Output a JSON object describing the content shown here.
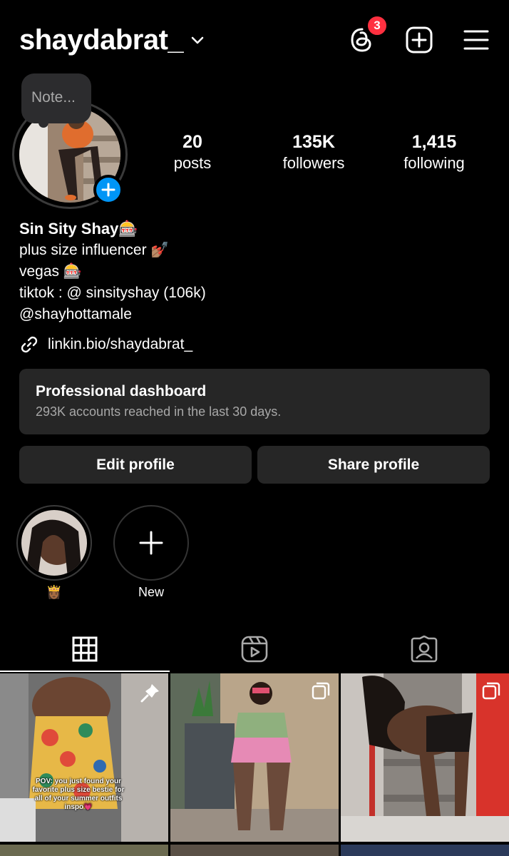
{
  "header": {
    "username": "shaydabrat_",
    "threads_badge_count": "3",
    "icons": [
      "chevron-down-icon",
      "threads-icon",
      "create-post-icon",
      "menu-icon"
    ]
  },
  "note": {
    "placeholder": "Note..."
  },
  "stats": [
    {
      "value": "20",
      "label": "posts"
    },
    {
      "value": "135K",
      "label": "followers"
    },
    {
      "value": "1,415",
      "label": "following"
    }
  ],
  "bio": {
    "name": "Sin Sity Shay🎰",
    "lines": [
      "plus size influencer 💅🏽",
      "vegas 🎰",
      "tiktok : @ sinsityshay (106k)",
      "@shayhottamale"
    ],
    "link": "linkin.bio/shaydabrat_"
  },
  "dashboard": {
    "title": "Professional dashboard",
    "subtitle": "293K accounts reached in the last 30 days."
  },
  "buttons": {
    "edit": "Edit profile",
    "share": "Share profile"
  },
  "highlights": [
    {
      "label": "👸🏾"
    },
    {
      "label": "New"
    }
  ],
  "tabs": [
    "grid-icon",
    "reels-icon",
    "tagged-icon"
  ],
  "posts": [
    {
      "caption": "POV: you just found your favorite plus size bestie for all of your summer outfits inspo💗",
      "pinned": true
    },
    {
      "caption": "",
      "multi": true
    },
    {
      "caption": "",
      "multi": true
    }
  ],
  "colors": {
    "accent": "#0095f6",
    "badge": "#ff3040",
    "surface": "#262626"
  }
}
